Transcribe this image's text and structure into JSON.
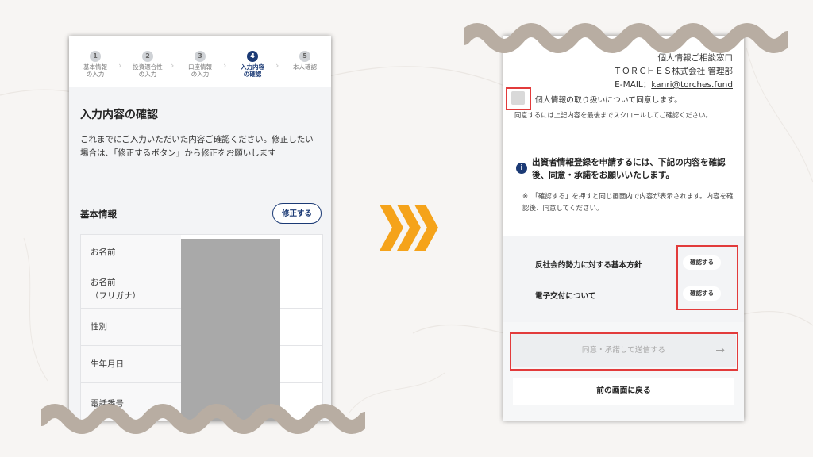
{
  "left": {
    "steps": [
      {
        "num": "1",
        "label": "基本情報\nの入力"
      },
      {
        "num": "2",
        "label": "投資適合性\nの入力"
      },
      {
        "num": "3",
        "label": "口座情報\nの入力"
      },
      {
        "num": "4",
        "label": "入力内容\nの確認"
      },
      {
        "num": "5",
        "label": "本人確認"
      }
    ],
    "title": "入力内容の確認",
    "description": "これまでにご入力いただいた内容ご確認ください。修正したい場合は、「修正するボタン」から修正をお願いします",
    "section_title": "基本情報",
    "edit_button": "修正する",
    "rows": [
      {
        "label": "お名前"
      },
      {
        "label": "お名前\n（フリガナ）"
      },
      {
        "label": "性別"
      },
      {
        "label": "生年月日"
      },
      {
        "label": "電話番号"
      }
    ]
  },
  "right": {
    "contact_title": "個人情報ご相談窓口",
    "company": "ＴＯＲＣＨＥＳ株式会社 管理部",
    "email_prefix": "E-MAIL：",
    "email": "kanri@torches.fund",
    "consent_label": "個人情報の取り扱いについて同意します。",
    "consent_note": "同意するには上記内容を最後までスクロールしてご確認ください。",
    "notice_text": "出資者情報登録を申請するには、下記の内容を確認後、同意・承諾をお願いいたします。",
    "notice_sub": "※　「確認する」を押すと同じ画面内で内容が表示されます。内容を確認後、同意してください。",
    "confirm_items": [
      {
        "label": "反社会的勢力に対する基本方針",
        "button": "確認する"
      },
      {
        "label": "電子交付について",
        "button": "確認する"
      }
    ],
    "submit_button": "同意・承諾して送信する",
    "back_button": "前の画面に戻る"
  },
  "colors": {
    "accent_navy": "#1b3a75",
    "highlight_red": "#e23b3b",
    "chevron_orange": "#f5a31a",
    "wave_taupe": "#b8ada2"
  }
}
